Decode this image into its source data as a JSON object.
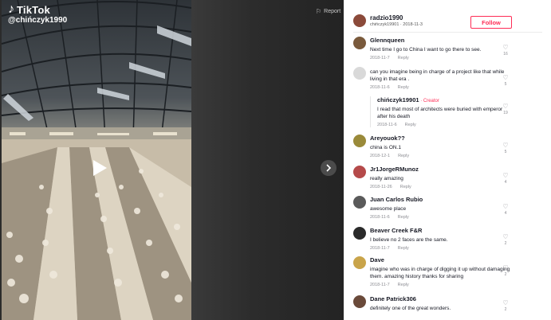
{
  "video": {
    "brand": "TikTok",
    "username": "@chińczyk1990",
    "report_label": "Report"
  },
  "author": {
    "name": "radzio1990",
    "handle": "chińczyk19901",
    "date": "2018-11-3",
    "follow_label": "Follow",
    "avatar_color": "#8b4a3a"
  },
  "comments": [
    {
      "name": "Glennqueen",
      "text": "Next time I go to China I want to go there to see.",
      "date": "2018-11-7",
      "reply": "Reply",
      "likes": "16",
      "avatar_color": "#7a5a3c"
    },
    {
      "name": "",
      "text": "can you imagine being in charge of a project like that while living in that era .",
      "date": "2018-11-6",
      "reply": "Reply",
      "likes": "5",
      "avatar_color": "#d9d9d9"
    },
    {
      "name": "Areyouok??",
      "text": "china is ON.1",
      "date": "2018-12-1",
      "reply": "Reply",
      "likes": "5",
      "avatar_color": "#9a8a3a"
    },
    {
      "name": "Jr1JorgeRMunoz",
      "text": "really amazing",
      "date": "2018-11-26",
      "reply": "Reply",
      "likes": "4",
      "avatar_color": "#b54a4a"
    },
    {
      "name": "Juan Carlos Rubio",
      "text": "awesome place",
      "date": "2018-11-6",
      "reply": "Reply",
      "likes": "4",
      "avatar_color": "#5a5a5a"
    },
    {
      "name": "Beaver Creek F&R",
      "text": "I believe no 2 faces are the same.",
      "date": "2018-11-7",
      "reply": "Reply",
      "likes": "2",
      "avatar_color": "#2a2a2a"
    },
    {
      "name": "Dave",
      "text": "imagine who was in charge of digging it up without damaging them. amazing history thanks for sharing",
      "date": "2018-11-7",
      "reply": "Reply",
      "likes": "2",
      "avatar_color": "#c9a44a"
    },
    {
      "name": "Dane Patrick306",
      "text": "definitely one of the great wonders.",
      "date": "",
      "reply": "",
      "likes": "2",
      "avatar_color": "#6a4a3a"
    }
  ],
  "creator_reply": {
    "name": "chińczyk19901",
    "badge": " · Creator",
    "text": "I read that most of architects were buried with emperor after his death",
    "date": "2018-11-6",
    "reply": "Reply",
    "likes": "19"
  },
  "colors": {
    "accent": "#fe2c55",
    "text": "#161823",
    "muted": "#8a8b91"
  }
}
